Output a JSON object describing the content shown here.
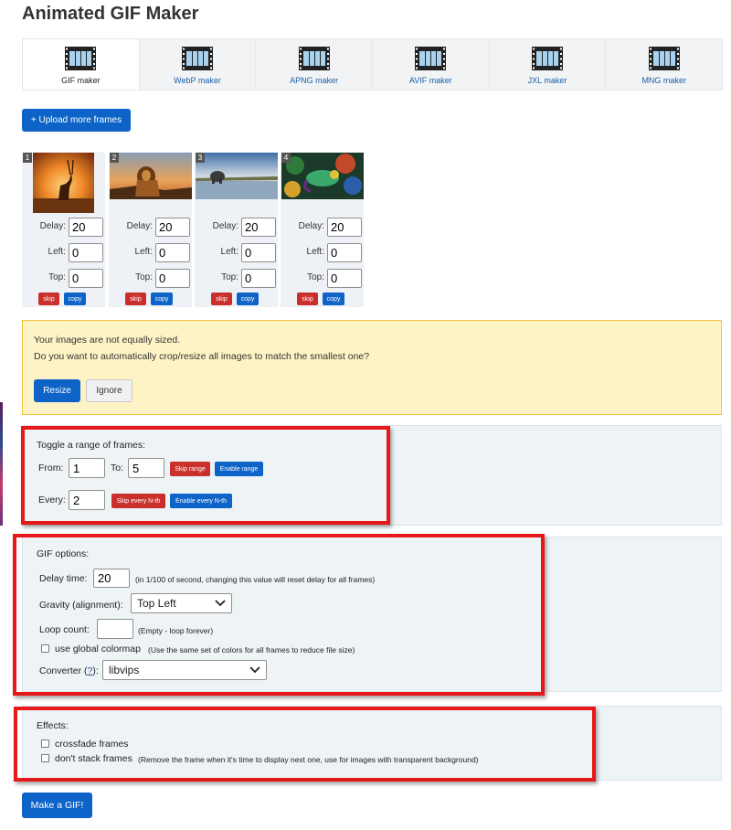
{
  "page": {
    "title": "Animated GIF Maker"
  },
  "tabs": [
    {
      "label": "GIF maker",
      "active": true
    },
    {
      "label": "WebP maker"
    },
    {
      "label": "APNG maker"
    },
    {
      "label": "AVIF maker"
    },
    {
      "label": "JXL maker"
    },
    {
      "label": "MNG maker"
    }
  ],
  "upload_button": "+ Upload more frames",
  "frames": [
    {
      "number": "1",
      "image": "antelope-sunset",
      "delay_label": "Delay:",
      "delay": "20",
      "left_label": "Left:",
      "left": "0",
      "top_label": "Top:",
      "top": "0",
      "skip": "skip",
      "copy": "copy"
    },
    {
      "number": "2",
      "image": "lion-on-rock",
      "delay_label": "Delay:",
      "delay": "20",
      "left_label": "Left:",
      "left": "0",
      "top_label": "Top:",
      "top": "0",
      "skip": "skip",
      "copy": "copy"
    },
    {
      "number": "3",
      "image": "elephant-lake",
      "delay_label": "Delay:",
      "delay": "20",
      "left_label": "Left:",
      "left": "0",
      "top_label": "Top:",
      "top": "0",
      "skip": "skip",
      "copy": "copy"
    },
    {
      "number": "4",
      "image": "chameleon-foliage",
      "delay_label": "Delay:",
      "delay": "20",
      "left_label": "Left:",
      "left": "0",
      "top_label": "Top:",
      "top": "0",
      "skip": "skip",
      "copy": "copy"
    }
  ],
  "warning": {
    "line1": "Your images are not equally sized.",
    "line2": "Do you want to automatically crop/resize all images to match the smallest one?",
    "resize": "Resize",
    "ignore": "Ignore"
  },
  "toggle": {
    "title": "Toggle a range of frames:",
    "from_label": "From:",
    "from": "1",
    "to_label": "To:",
    "to": "5",
    "skip_range": "Skip range",
    "enable_range": "Enable range",
    "every_label": "Every:",
    "every": "2",
    "skip_nth": "Skip every N-th",
    "enable_nth": "Enable every N-th"
  },
  "gif_options": {
    "title": "GIF options:",
    "delay_label": "Delay time:",
    "delay": "20",
    "delay_note": "(in 1/100 of second, changing this value will reset delay for all frames)",
    "gravity_label": "Gravity (alignment):",
    "gravity": "Top Left",
    "loop_label": "Loop count:",
    "loop": "",
    "loop_note": "(Empty - loop forever)",
    "colormap_label": "use global colormap",
    "colormap_note": "(Use the same set of colors for all frames to reduce file size)",
    "converter_label": "Converter (",
    "converter_link": "?",
    "converter_label_end": "):",
    "converter": "libvips"
  },
  "effects": {
    "title": "Effects:",
    "crossfade_label": "crossfade frames",
    "nostack_label": "don't stack frames",
    "nostack_note": "(Remove the frame when it's time to display next one, use for images with transparent background)"
  },
  "make_button": "Make a GIF!",
  "colors": {
    "primary": "#0d63c7",
    "danger": "#c9302c",
    "warning_bg": "#fdf3c4",
    "highlight": "#e6181a"
  }
}
